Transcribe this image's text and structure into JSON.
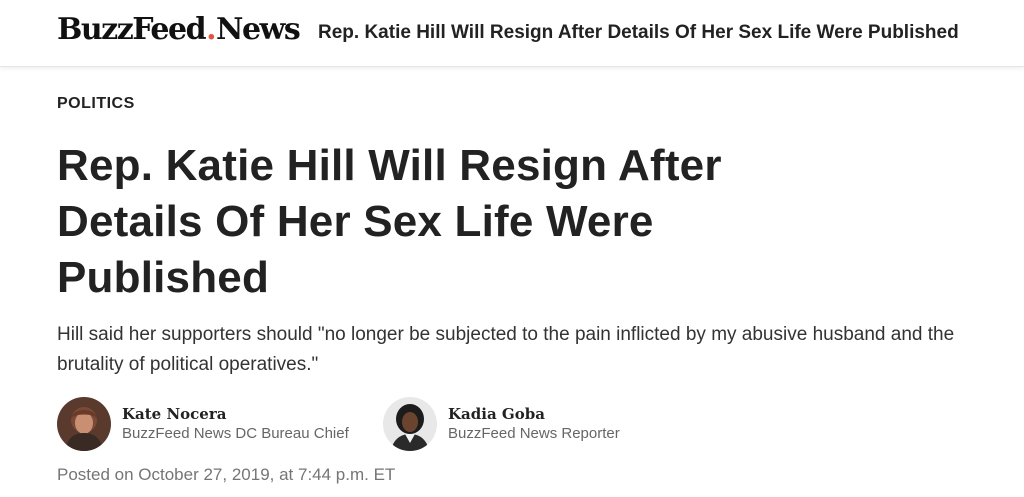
{
  "header": {
    "logo_main": "BuzzFeed",
    "logo_dot": ".",
    "logo_sub": "News",
    "headline": "Rep. Katie Hill Will Resign After Details Of Her Sex Life Were Published"
  },
  "article": {
    "category": "POLITICS",
    "title": "Rep. Katie Hill Will Resign After Details Of Her Sex Life Were Published",
    "dek": "Hill said her supporters should \"no longer be subjected to the pain inflicted by my abusive husband and the brutality of political operatives.\"",
    "authors": [
      {
        "name": "Kate Nocera",
        "role": "BuzzFeed News DC Bureau Chief"
      },
      {
        "name": "Kadia Goba",
        "role": "BuzzFeed News Reporter"
      }
    ],
    "timestamp": "Posted on October 27, 2019, at 7:44 p.m. ET"
  },
  "colors": {
    "logo_dot": "#e2543f",
    "text": "#222222",
    "muted": "#757575"
  }
}
